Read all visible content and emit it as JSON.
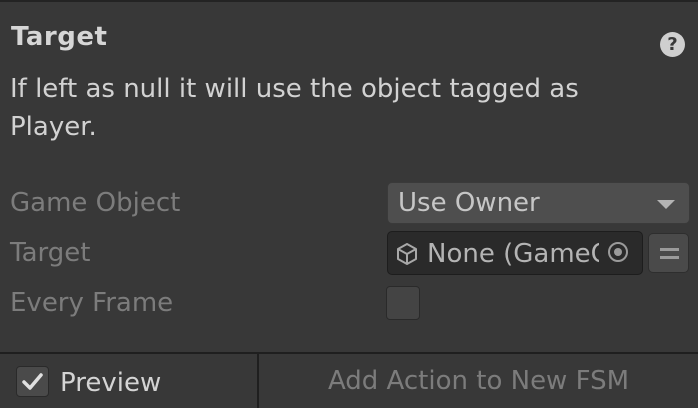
{
  "section": {
    "title": "Target",
    "description": "If left as null it will use the object tagged as Player."
  },
  "fields": {
    "game_object": {
      "label": "Game Object",
      "value": "Use Owner"
    },
    "target": {
      "label": "Target",
      "value": "None (GameObject)"
    },
    "every_frame": {
      "label": "Every Frame",
      "checked": false
    }
  },
  "footer": {
    "preview_label": "Preview",
    "preview_checked": true,
    "add_action_label": "Add Action to New FSM"
  },
  "icons": {
    "help": "help-icon",
    "cube": "gameobject-cube-icon",
    "picker": "object-picker-icon",
    "variable_toggle": "variable-toggle-icon",
    "dropdown": "dropdown-caret-icon",
    "check": "checkmark-icon"
  }
}
